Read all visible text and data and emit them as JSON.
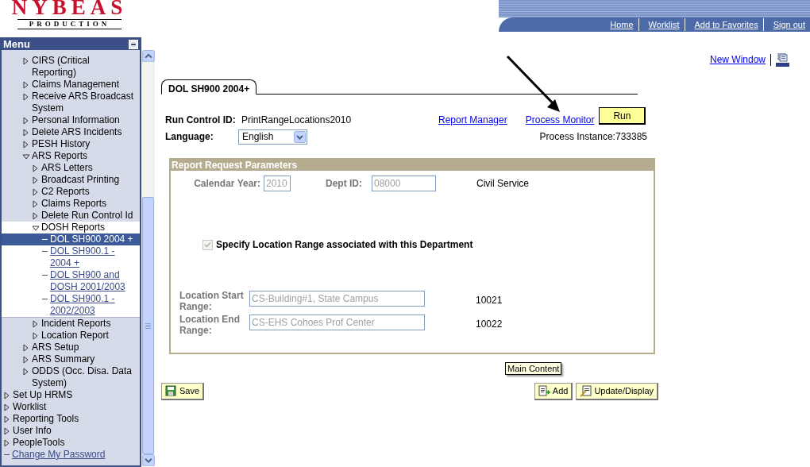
{
  "header": {
    "logo_title": "NYBEAS",
    "logo_subtitle": "PRODUCTION",
    "nav": [
      "Home",
      "Worklist",
      "Add to Favorites",
      "Sign out"
    ]
  },
  "menu": {
    "title": "Menu",
    "items": [
      {
        "children": [
          {
            "kind": "folder",
            "label": "CIRS (Critical Reporting)",
            "expanded": false,
            "selected": false
          },
          {
            "kind": "folder",
            "label": "Claims Management",
            "expanded": false,
            "selected": false
          },
          {
            "kind": "folder",
            "label": "Receive ARS Broadcast System",
            "expanded": false,
            "selected": false
          },
          {
            "kind": "folder",
            "label": "Personal Information",
            "expanded": false,
            "selected": false
          },
          {
            "kind": "folder",
            "label": "Delete ARS Incidents",
            "expanded": false,
            "selected": false
          },
          {
            "kind": "folder",
            "label": "PESH History",
            "expanded": false,
            "selected": false
          },
          {
            "kind": "folder",
            "label": "ARS Reports",
            "expanded": true,
            "selected": false,
            "children": [
              {
                "kind": "folder",
                "label": "ARS Letters",
                "expanded": false,
                "selected": false
              },
              {
                "kind": "folder",
                "label": "Broadcast Printing",
                "expanded": false,
                "selected": false
              },
              {
                "kind": "folder",
                "label": "C2 Reports",
                "expanded": false,
                "selected": false
              },
              {
                "kind": "folder",
                "label": "Claims Reports",
                "expanded": false,
                "selected": false
              },
              {
                "kind": "folder",
                "label": "Delete Run Control Id",
                "expanded": false,
                "selected": false
              },
              {
                "kind": "folder",
                "label": "DOSH Reports",
                "expanded": true,
                "selected": false,
                "children": [
                  {
                    "kind": "link",
                    "label": "DOL SH900 2004 +",
                    "selected": true
                  },
                  {
                    "kind": "link",
                    "label": "DOL SH900.1 - 2004 +",
                    "selected": false
                  },
                  {
                    "kind": "link",
                    "label": "DOL SH900 and DOSH 2001/2003",
                    "selected": false
                  },
                  {
                    "kind": "link",
                    "label": "DOL SH900.1 - 2002/2003",
                    "selected": false
                  }
                ]
              },
              {
                "kind": "folder",
                "label": "Incident Reports",
                "expanded": false,
                "selected": false
              },
              {
                "kind": "folder",
                "label": "Location Report",
                "expanded": false,
                "selected": false
              }
            ]
          },
          {
            "kind": "folder",
            "label": "ARS Setup",
            "expanded": false,
            "selected": false
          },
          {
            "kind": "folder",
            "label": "ARS Summary",
            "expanded": false,
            "selected": false
          },
          {
            "kind": "folder",
            "label": "ODDS (Occ. Disa. Data System)",
            "expanded": false,
            "selected": false
          }
        ]
      },
      {
        "kind": "folder",
        "label": "Set Up HRMS",
        "expanded": false,
        "selected": false
      },
      {
        "kind": "folder",
        "label": "Worklist",
        "expanded": false,
        "selected": false
      },
      {
        "kind": "folder",
        "label": "Reporting Tools",
        "expanded": false,
        "selected": false
      },
      {
        "kind": "folder",
        "label": "User Info",
        "expanded": false,
        "selected": false
      },
      {
        "kind": "folder",
        "label": "PeopleTools",
        "expanded": false,
        "selected": false
      },
      {
        "kind": "link",
        "label": "Change My Password",
        "selected": false
      }
    ]
  },
  "new_window": "New Window",
  "tabs": [
    {
      "label": "DOL SH900 2004+",
      "selected": true
    }
  ],
  "run_control": {
    "label": "Run Control ID:",
    "value": "PrintRangeLocations2010"
  },
  "links": [
    "Report Manager",
    "Process Monitor"
  ],
  "run_button": "Run",
  "language": {
    "label": "Language:",
    "value": "English"
  },
  "process_instance": "Process Instance:733385",
  "parameters": {
    "title": "Report Request Parameters",
    "calendar_year": {
      "label": "Calendar Year:",
      "value": "2010",
      "disabled": true
    },
    "dept_id": {
      "label": "Dept ID:",
      "value": "08000",
      "disabled": true
    },
    "dept_name": "Civil Service",
    "location_range": {
      "label": "Specify Location Range associated with this Department",
      "checked": true,
      "disabled": true
    },
    "locations": [
      {
        "label": "Location Start Range:",
        "value": "CS-Building#1, State Campus",
        "code": "10021",
        "disabled": true
      },
      {
        "label": "Location End Range:",
        "value": "CS-EHS Cohoes Prof Center",
        "code": "10022",
        "disabled": true
      }
    ]
  },
  "tooltip": "Main Content",
  "buttons": [
    {
      "label": "Save",
      "kind": "save"
    },
    {
      "label": "Add",
      "kind": "add"
    },
    {
      "label": "Update/Display",
      "kind": "update"
    }
  ]
}
